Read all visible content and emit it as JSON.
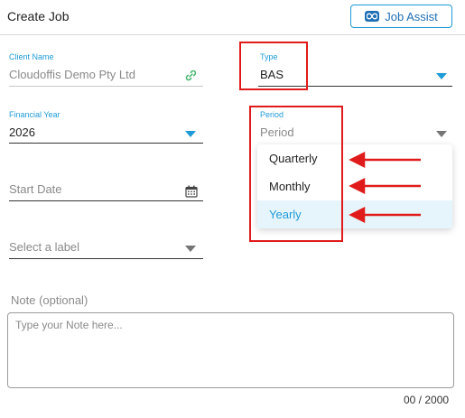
{
  "header": {
    "title": "Create Job",
    "assist_button_label": "Job Assist"
  },
  "form": {
    "client_name": {
      "label": "Client Name",
      "value": "Cloudoffis Demo Pty Ltd"
    },
    "type": {
      "label": "Type",
      "value": "BAS"
    },
    "financial_year": {
      "label": "Financial Year",
      "value": "2026"
    },
    "period": {
      "label": "Period",
      "placeholder": "Period",
      "options": [
        "Quarterly",
        "Monthly",
        "Yearly"
      ],
      "highlighted_option": "Yearly",
      "open": true
    },
    "start_date": {
      "placeholder": "Start Date"
    },
    "label_select": {
      "placeholder": "Select a label"
    },
    "note": {
      "label": "Note (optional)",
      "placeholder": "Type your Note here...",
      "counter": "00 / 2000"
    }
  },
  "colors": {
    "accent": "#1f9bd7",
    "annotation_red": "#e01b1b",
    "selected_bg": "#e6f5fb"
  },
  "icons": [
    "infinity-icon",
    "link-icon",
    "calendar-icon",
    "chevron-down-icon"
  ]
}
